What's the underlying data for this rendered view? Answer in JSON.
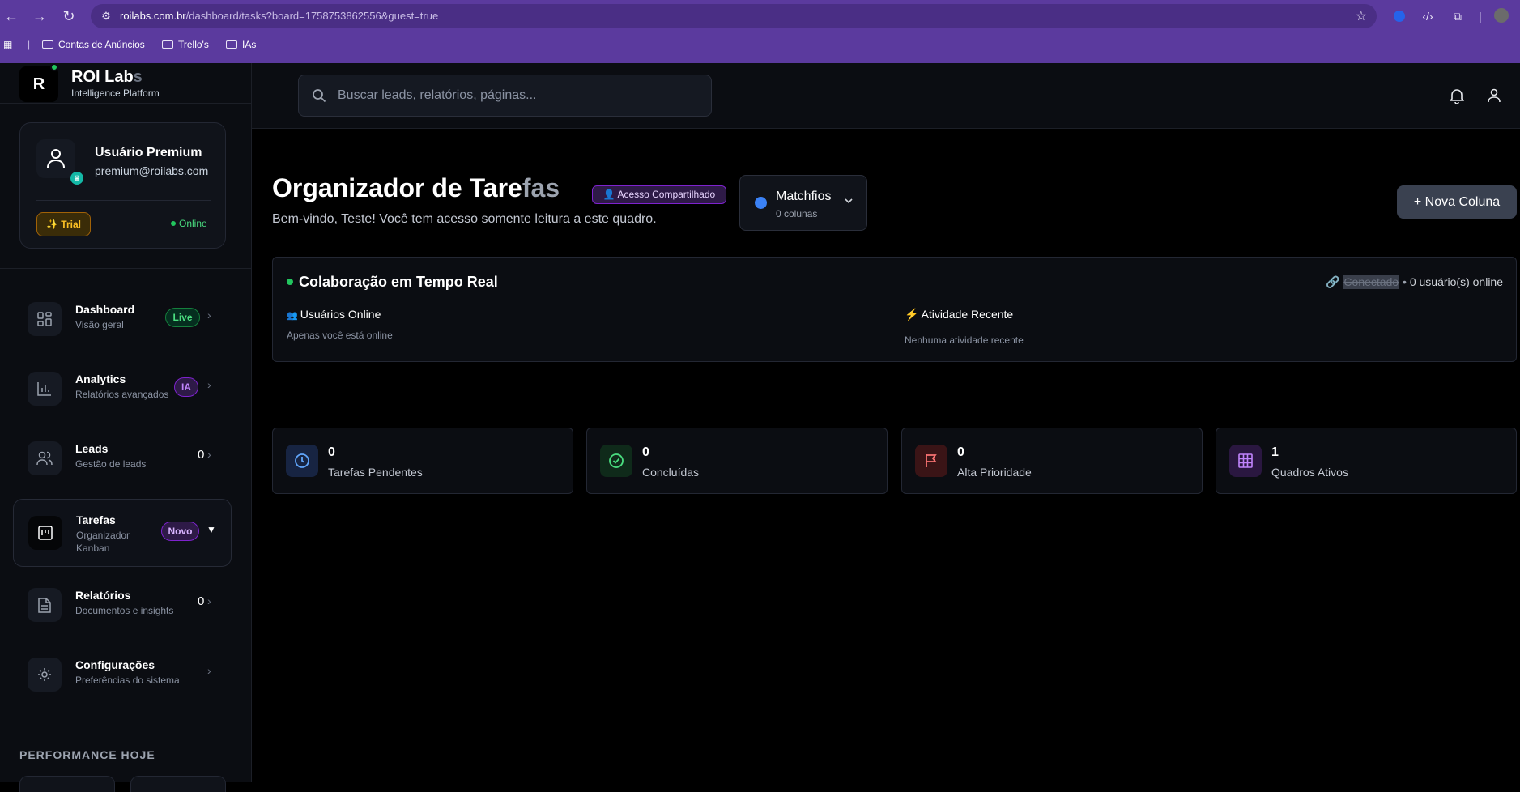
{
  "browser": {
    "url_host": "roilabs.com.br",
    "url_path": "/dashboard/tasks?board=1758753862556&guest=true",
    "bookmarks": [
      "Contas de Anúncios",
      "Trello's",
      "IAs"
    ]
  },
  "brand": {
    "logo_letter": "R",
    "name_main": "ROI Lab",
    "name_fade": "s",
    "subtitle": "Intelligence Platform"
  },
  "user": {
    "name": "Usuário Premium",
    "email": "premium@roilabs.com",
    "plan": "✨ Trial",
    "status": "Online"
  },
  "nav": [
    {
      "title": "Dashboard",
      "sub": "Visão geral",
      "badge": "Live",
      "icon": "dashboard-grid-icon"
    },
    {
      "title": "Analytics",
      "sub": "Relatórios avançados",
      "badge": "IA",
      "icon": "bar-chart-icon"
    },
    {
      "title": "Leads",
      "sub": "Gestão de leads",
      "count": "0",
      "icon": "users-icon"
    },
    {
      "title": "Tarefas",
      "sub": "Organizador Kanban",
      "badge": "Novo",
      "icon": "kanban-icon",
      "active": true
    },
    {
      "title": "Relatórios",
      "sub": "Documentos e insights",
      "count": "0",
      "icon": "document-icon"
    },
    {
      "title": "Configurações",
      "sub": "Preferências do sistema",
      "icon": "gear-icon"
    }
  ],
  "sidebar_footer": {
    "performance_label": "PERFORMANCE HOJE"
  },
  "search": {
    "placeholder": "Buscar leads, relatórios, páginas..."
  },
  "page": {
    "title_main": "Organizador de Tare",
    "title_fade": "fas",
    "shared_badge": "👤 Acesso Compartilhado",
    "welcome": "Bem-vindo, Teste! Você tem acesso somente leitura a este quadro.",
    "new_column_label": "Nova Coluna"
  },
  "board": {
    "name": "Matchfios",
    "columns": "0 colunas",
    "color": "#3b82f6"
  },
  "collab": {
    "title": "Colaboração em Tempo Real",
    "connection": "Conectado",
    "online_count": "0 usuário(s) online",
    "online_users_title": "Usuários Online",
    "online_users_text": "Apenas você está online",
    "activity_title": "Atividade Recente",
    "activity_text": "Nenhuma atividade recente"
  },
  "stats": [
    {
      "value": "0",
      "label": "Tarefas Pendentes",
      "icon": "clock-icon",
      "color": "#60a5fa"
    },
    {
      "value": "0",
      "label": "Concluídas",
      "icon": "check-circle-icon",
      "color": "#4ade80"
    },
    {
      "value": "0",
      "label": "Alta Prioridade",
      "icon": "flag-icon",
      "color": "#f87171"
    },
    {
      "value": "1",
      "label": "Quadros Ativos",
      "icon": "grid-icon",
      "color": "#c084fc"
    }
  ]
}
